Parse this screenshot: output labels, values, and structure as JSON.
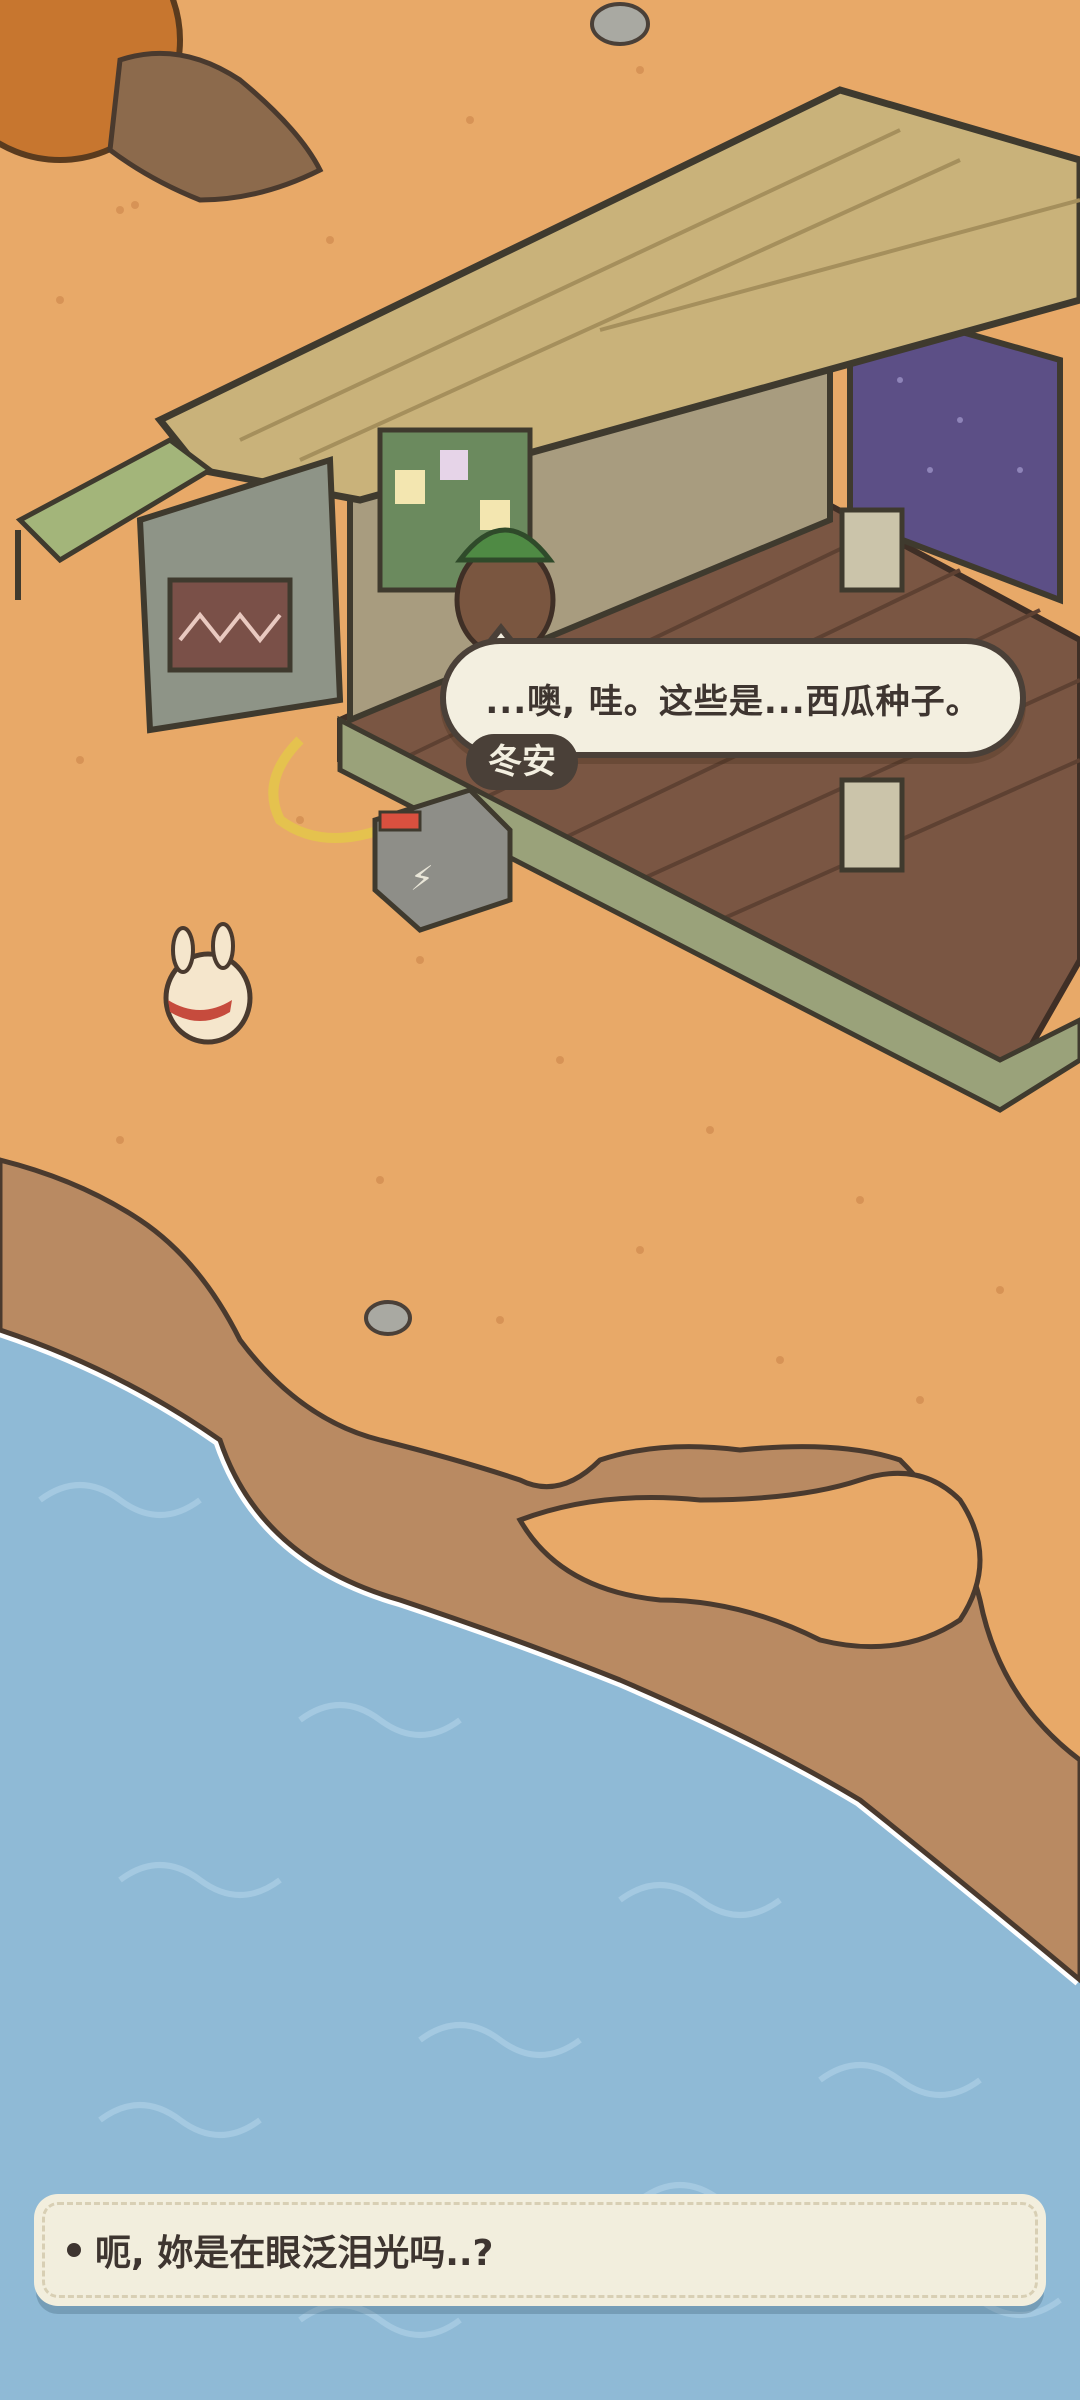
{
  "dialogue": {
    "line": "...噢, 哇。这些是...西瓜种子。",
    "speaker": "冬安"
  },
  "choices": [
    {
      "text": "呃, 妳是在眼泛泪光吗..?"
    }
  ],
  "colors": {
    "sand": "#e8a968",
    "water": "#8fbad6",
    "cliff": "#b98a62",
    "wood_roof": "#c9b27a",
    "dialog_bg": "#f3efe0",
    "dialog_border": "#4a4038"
  }
}
